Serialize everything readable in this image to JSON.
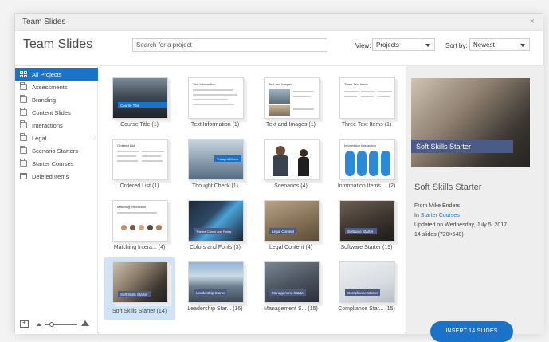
{
  "window": {
    "title": "Team Slides",
    "close_glyph": "×"
  },
  "header": {
    "title": "Team Slides",
    "search_placeholder": "Search for a project",
    "view_label": "View:",
    "view_value": "Projects",
    "sort_label": "Sort by:",
    "sort_value": "Newest"
  },
  "sidebar": {
    "items": [
      {
        "label": "All Projects",
        "icon": "grid-icon",
        "active": true
      },
      {
        "label": "Assessments",
        "icon": "folder-icon"
      },
      {
        "label": "Branding",
        "icon": "folder-icon"
      },
      {
        "label": "Content Slides",
        "icon": "folder-icon"
      },
      {
        "label": "Interactions",
        "icon": "folder-icon"
      },
      {
        "label": "Legal",
        "icon": "folder-icon"
      },
      {
        "label": "Scenario Starters",
        "icon": "folder-icon"
      },
      {
        "label": "Starter Courses",
        "icon": "folder-icon"
      },
      {
        "label": "Deleted Items",
        "icon": "trash-icon"
      }
    ]
  },
  "tiles": [
    {
      "label": "Course Title",
      "count": "(1)",
      "band": "Course Title"
    },
    {
      "label": "Text Information",
      "count": "(1)",
      "head": "Text Information"
    },
    {
      "label": "Text and Images",
      "count": "(1)",
      "head": "Text and Images"
    },
    {
      "label": "Three Text Items",
      "count": "(1)",
      "head": "Three Text Items"
    },
    {
      "label": "Ordered List",
      "count": "(1)",
      "head": "Ordered List"
    },
    {
      "label": "Thought Check",
      "count": "(1)",
      "band": "Thought Check"
    },
    {
      "label": "Scenarios",
      "count": "(4)"
    },
    {
      "label": "Information Items ...",
      "count": "(2)",
      "head": "Information Interaction"
    },
    {
      "label": "Matching Intera...",
      "count": "(4)",
      "head": "Matching Interaction"
    },
    {
      "label": "Colors and Fonts",
      "count": "(3)",
      "band": "Theme Colors and Fonts"
    },
    {
      "label": "Legal Content",
      "count": "(4)",
      "band": "Legal Content"
    },
    {
      "label": "Software Starter",
      "count": "(19)",
      "band": "Software Starter"
    },
    {
      "label": "Soft Skills Starter",
      "count": "(14)",
      "band": "Soft Skills Starter"
    },
    {
      "label": "Leadership Star...",
      "count": "(16)",
      "band": "Leadership Starter"
    },
    {
      "label": "Management S...",
      "count": "(15)",
      "band": "Management Starter"
    },
    {
      "label": "Compliance Star...",
      "count": "(15)",
      "band": "Compliance Starter"
    }
  ],
  "preview": {
    "band_text": "Soft Skills Starter",
    "title": "Soft Skills Starter",
    "from": "From Mike Enders",
    "in_prefix": "In",
    "in_link": "Starter Courses",
    "updated": "Updated on Wednesday, July 5, 2017",
    "slides": "14 slides (720×540)",
    "button": "INSERT 14 SLIDES"
  },
  "colors": {
    "accent": "#1a73c9",
    "band": "#4b5a86",
    "selected": "#cfe4f7"
  }
}
